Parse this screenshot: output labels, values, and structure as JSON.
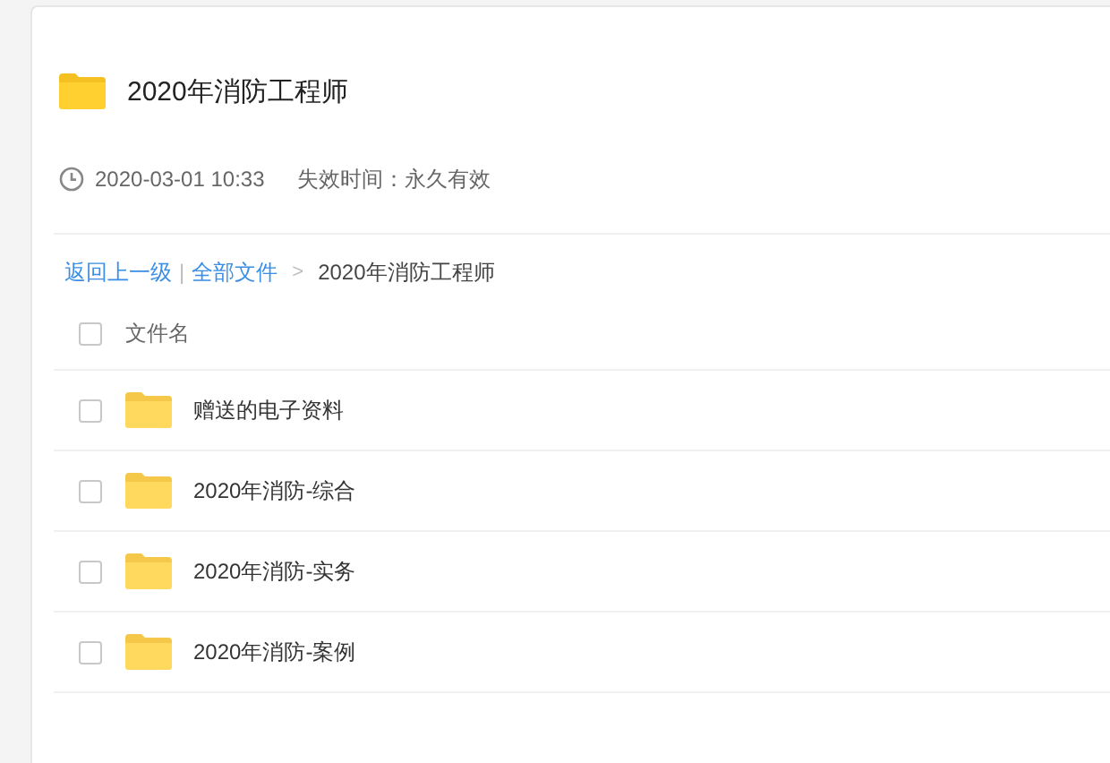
{
  "share": {
    "title": "2020年消防工程师",
    "created": "2020-03-01 10:33",
    "expiry": "失效时间：永久有效"
  },
  "breadcrumb": {
    "back": "返回上一级",
    "separator": "|",
    "root": "全部文件",
    "arrow": ">",
    "current": "2020年消防工程师"
  },
  "table": {
    "header": {
      "label": "文件名",
      "checked": false
    },
    "rows": [
      {
        "name": "赠送的电子资料",
        "checked": false
      },
      {
        "name": "2020年消防-综合",
        "checked": false
      },
      {
        "name": "2020年消防-实务",
        "checked": false
      },
      {
        "name": "2020年消防-案例",
        "checked": false
      }
    ]
  }
}
